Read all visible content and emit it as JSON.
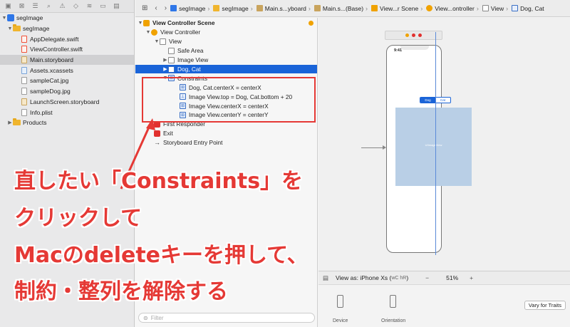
{
  "navigator": {
    "project": "segImage",
    "group": "segImage",
    "files": [
      "AppDelegate.swift",
      "ViewController.swift",
      "Main.storyboard",
      "Assets.xcassets",
      "sampleCat.jpg",
      "sampleDog.jpg",
      "LaunchScreen.storyboard",
      "Info.plist"
    ],
    "products": "Products",
    "selected_file": "Main.storyboard"
  },
  "breadcrumb": [
    "segImage",
    "segImage",
    "Main.s...yboard",
    "Main.s...(Base)",
    "View...r Scene",
    "View...ontroller",
    "View",
    "Dog, Cat"
  ],
  "outline": {
    "scene": "View Controller Scene",
    "vc": "View Controller",
    "view": "View",
    "safe_area": "Safe Area",
    "image_view": "Image View",
    "seg": "Dog, Cat",
    "constraints": "Constraints",
    "c1": "Dog, Cat.centerX = centerX",
    "c2": "Image View.top = Dog, Cat.bottom + 20",
    "c3": "Image View.centerX = centerX",
    "c4": "Image View.centerY = centerY",
    "first_responder": "First Responder",
    "exit": "Exit",
    "entry": "Storyboard Entry Point",
    "filter_placeholder": "Filter"
  },
  "canvas": {
    "time": "9:41",
    "seg_left": "Dog",
    "seg_right": "Cat",
    "image_label": "UIImageView"
  },
  "bottom_bar": {
    "view_as": "View as: iPhone Xs (",
    "view_as_keys": "wC hR",
    "view_as_end": ")",
    "minus": "−",
    "zoom": "51%",
    "plus": "+",
    "device": "Device",
    "orientation": "Orientation",
    "vary": "Vary for Traits"
  },
  "annotation": {
    "line1": "直したい「Constraints」を",
    "line2": "クリックして",
    "line3": "Macのdeleteキーを押して、",
    "line4": "制約・整列を解除する"
  },
  "colors": {
    "accent": "#1a64d8",
    "annotation": "#e53935"
  }
}
